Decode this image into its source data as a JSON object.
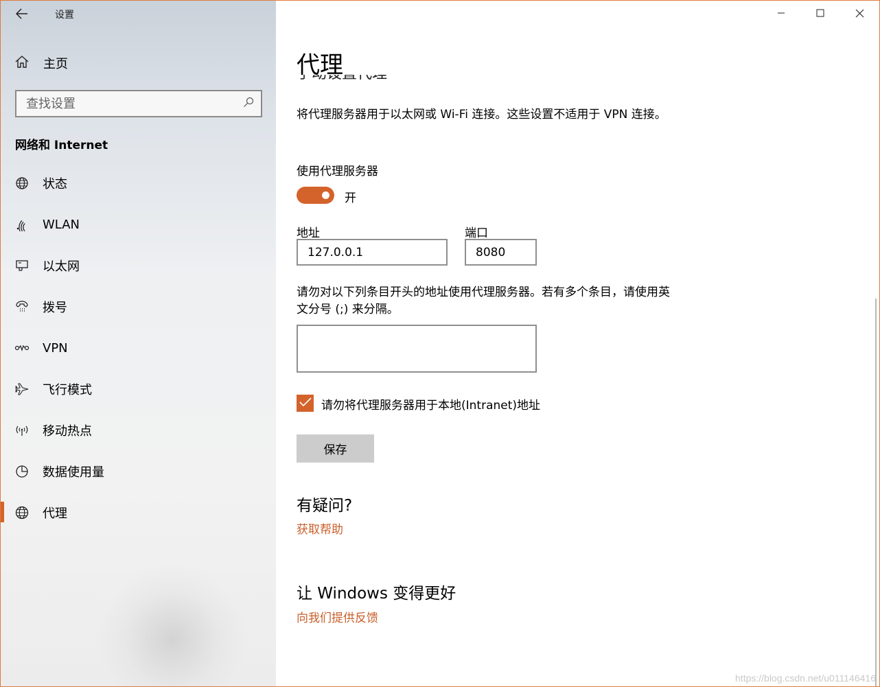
{
  "window": {
    "app_title": "设置",
    "controls": {
      "minimize": "─",
      "maximize": "☐",
      "close": "✕"
    }
  },
  "sidebar": {
    "home_label": "主页",
    "search_placeholder": "查找设置",
    "section_title": "网络和 Internet",
    "items": [
      {
        "label": "状态",
        "icon": "status-globe-icon"
      },
      {
        "label": "WLAN",
        "icon": "wifi-icon"
      },
      {
        "label": "以太网",
        "icon": "ethernet-icon"
      },
      {
        "label": "拨号",
        "icon": "dialup-icon"
      },
      {
        "label": "VPN",
        "icon": "vpn-icon"
      },
      {
        "label": "飞行模式",
        "icon": "airplane-icon"
      },
      {
        "label": "移动热点",
        "icon": "hotspot-icon"
      },
      {
        "label": "数据使用量",
        "icon": "data-usage-icon"
      },
      {
        "label": "代理",
        "icon": "globe-icon",
        "active": true
      }
    ]
  },
  "main": {
    "page_title": "代理",
    "section_heading": "手动设置代理",
    "description": "将代理服务器用于以太网或 Wi-Fi 连接。这些设置不适用于 VPN 连接。",
    "use_proxy_label": "使用代理服务器",
    "toggle_state": "开",
    "address_label": "地址",
    "address_value": "127.0.0.1",
    "port_label": "端口",
    "port_value": "8080",
    "exceptions_description": "请勿对以下列条目开头的地址使用代理服务器。若有多个条目，请使用英文分号 (;) 来分隔。",
    "exceptions_value": "",
    "local_bypass_label": "请勿将代理服务器用于本地(Intranet)地址",
    "local_bypass_checked": true,
    "save_label": "保存",
    "questions_heading": "有疑问?",
    "help_link": "获取帮助",
    "feedback_heading": "让 Windows 变得更好",
    "feedback_link": "向我们提供反馈"
  },
  "watermark": "https://blog.csdn.net/u011146416",
  "colors": {
    "accent": "#d4632b",
    "link": "#c8602c"
  }
}
